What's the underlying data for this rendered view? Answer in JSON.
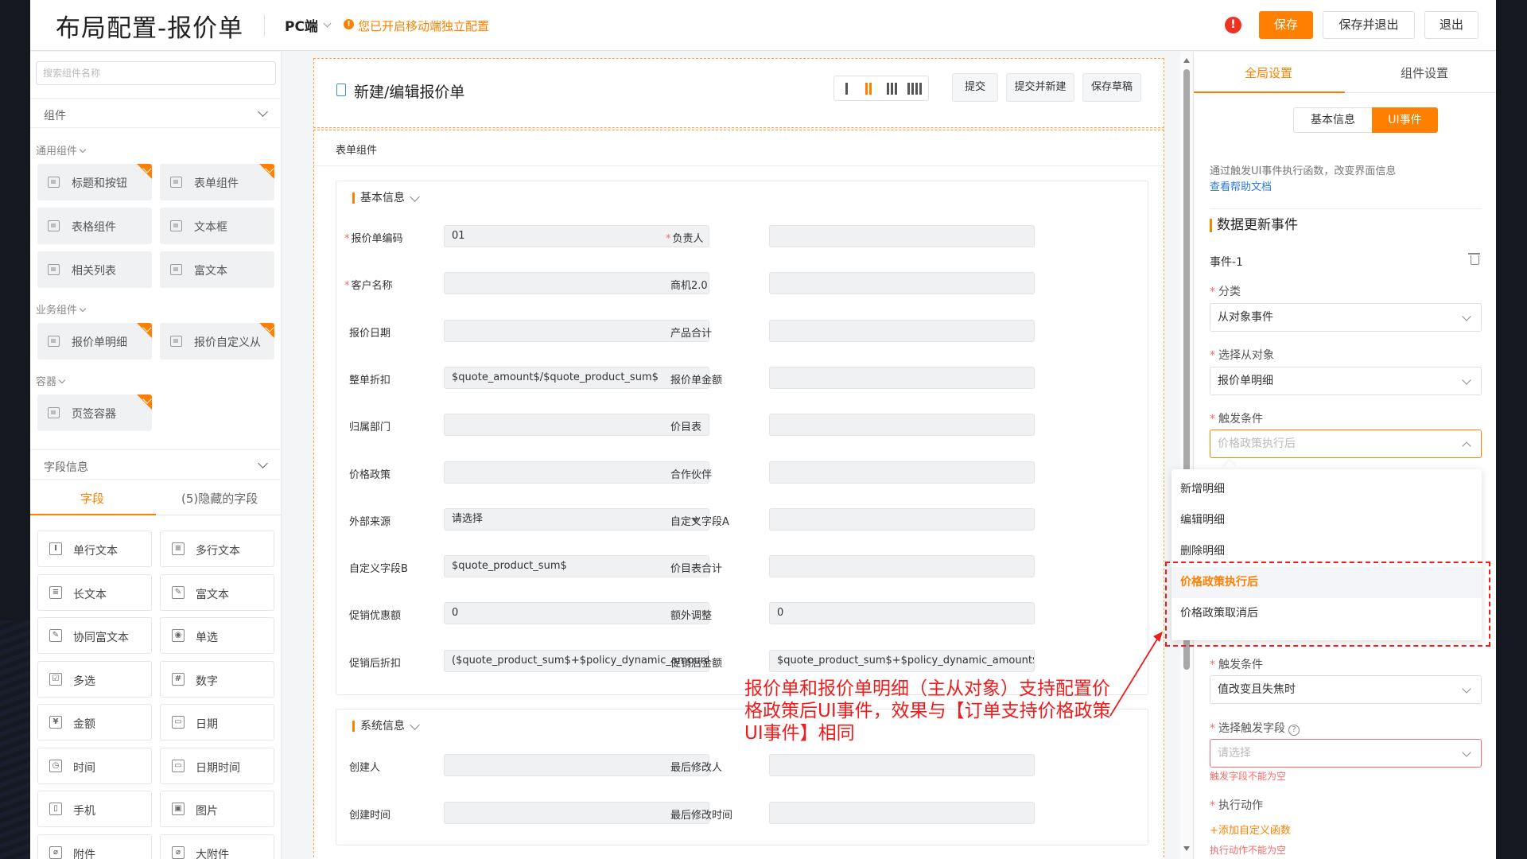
{
  "header": {
    "title": "布局配置-报价单",
    "platform": "PC端",
    "warning": "您已开启移动端独立配置",
    "alert_glyph": "!",
    "buttons": {
      "save": "保存",
      "save_exit": "保存并退出",
      "exit": "退出"
    }
  },
  "left": {
    "search_placeholder": "搜索组件名称",
    "components_title": "组件",
    "groups": {
      "general": "通用组件",
      "business": "业务组件",
      "container": "容器"
    },
    "general_items": [
      "标题和按钮",
      "表单组件",
      "表格组件",
      "文本框",
      "相关列表",
      "富文本"
    ],
    "business_items": [
      "报价单明细",
      "报价自定义从"
    ],
    "container_items": [
      "页签容器"
    ],
    "fields_title": "字段信息",
    "field_tabs": {
      "fields": "字段",
      "hidden": "(5)隐藏的字段"
    },
    "fields": [
      "单行文本",
      "多行文本",
      "长文本",
      "富文本",
      "协同富文本",
      "单选",
      "多选",
      "数字",
      "金额",
      "日期",
      "时间",
      "日期时间",
      "手机",
      "图片",
      "附件",
      "大附件"
    ],
    "field_glyphs": [
      "I",
      "≡",
      "≡",
      "✎",
      "✎",
      "◉",
      "☑",
      "#",
      "¥",
      "▭",
      "◷",
      "▭",
      "▯",
      "▣",
      "⌀",
      "⌀"
    ]
  },
  "form": {
    "title": "新建/编辑报价单",
    "buttons": {
      "submit": "提交",
      "submit_new": "提交并新建",
      "draft": "保存草稿"
    },
    "body_label": "表单组件",
    "basic_title": "基本信息",
    "system_title": "系统信息",
    "basic_fields": [
      {
        "label": "报价单编码",
        "value": "01",
        "required": "*"
      },
      {
        "label": "负责人",
        "value": "",
        "required": "*"
      },
      {
        "label": "客户名称",
        "value": "",
        "required": "*"
      },
      {
        "label": "商机2.0",
        "value": ""
      },
      {
        "label": "报价日期",
        "value": ""
      },
      {
        "label": "产品合计",
        "value": ""
      },
      {
        "label": "整单折扣",
        "value": "$quote_amount$/$quote_product_sum$"
      },
      {
        "label": "报价单金额",
        "value": ""
      },
      {
        "label": "归属部门",
        "value": ""
      },
      {
        "label": "价目表",
        "value": ""
      },
      {
        "label": "价格政策",
        "value": ""
      },
      {
        "label": "合作伙伴",
        "value": ""
      },
      {
        "label": "外部来源",
        "value": "请选择"
      },
      {
        "label": "自定义字段A",
        "value": ""
      },
      {
        "label": "自定义字段B",
        "value": "$quote_product_sum$"
      },
      {
        "label": "价目表合计",
        "value": ""
      },
      {
        "label": "促销优惠额",
        "value": "0"
      },
      {
        "label": "额外调整",
        "value": "0"
      },
      {
        "label": "促销后折扣",
        "value": "($quote_product_sum$+$policy_dynamic_amount$)/$"
      },
      {
        "label": "促销后金额",
        "value": "$quote_product_sum$+$policy_dynamic_amount$"
      }
    ],
    "system_fields": [
      {
        "label": "创建人",
        "value": ""
      },
      {
        "label": "最后修改人",
        "value": ""
      },
      {
        "label": "创建时间",
        "value": ""
      },
      {
        "label": "最后修改时间",
        "value": ""
      }
    ]
  },
  "right": {
    "tabs": {
      "global": "全局设置",
      "component": "组件设置"
    },
    "segments": {
      "basic": "基本信息",
      "ui": "UI事件"
    },
    "desc": "通过触发UI事件执行函数，改变界面信息",
    "help_link": "查看帮助文档",
    "section_title": "数据更新事件",
    "event_name": "事件-1",
    "category_label": "分类",
    "category_value": "从对象事件",
    "object_label": "选择从对象",
    "object_value": "报价单明细",
    "trigger_label": "触发条件",
    "trigger_placeholder": "价格政策执行后",
    "dropdown": [
      "新增明细",
      "编辑明细",
      "删除明细",
      "价格政策执行后",
      "价格政策取消后"
    ],
    "trigger2_label": "触发条件",
    "trigger2_value": "值改变且失焦时",
    "field_label": "选择触发字段",
    "field_placeholder": "请选择",
    "field_error": "触发字段不能为空",
    "action_label": "执行动作",
    "add_function": "+添加自定义函数",
    "action_error": "执行动作不能为空",
    "required_mark": "*",
    "help_glyph": "?"
  },
  "annotation": "报价单和报价单明细（主从对象）支持配置价格政策后UI事件，效果与【订单支持价格政策UI事件】相同",
  "colors": {
    "accent": "#ff8000",
    "error": "#ee1c1c",
    "link": "#2a7ae2"
  }
}
